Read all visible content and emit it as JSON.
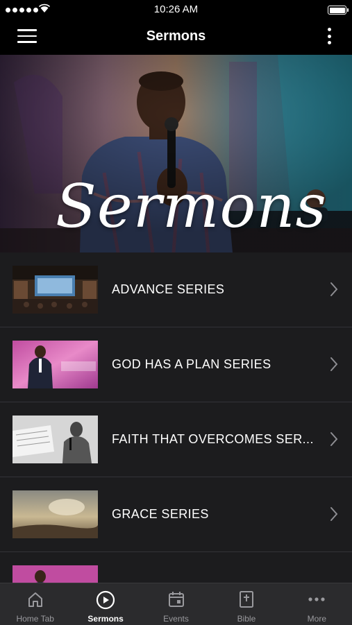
{
  "status_bar": {
    "time": "10:26 AM"
  },
  "nav": {
    "title": "Sermons"
  },
  "hero": {
    "script_text": "Sermons"
  },
  "sermon_list": [
    {
      "title": "ADVANCE SERIES"
    },
    {
      "title": "GOD HAS A PLAN SERIES"
    },
    {
      "title": "FAITH THAT OVERCOMES SER..."
    },
    {
      "title": "GRACE SERIES"
    },
    {
      "title": ""
    }
  ],
  "tabs": [
    {
      "label": "Home Tab",
      "icon": "home-icon"
    },
    {
      "label": "Sermons",
      "icon": "play-circle-icon",
      "active": true
    },
    {
      "label": "Events",
      "icon": "calendar-icon"
    },
    {
      "label": "Bible",
      "icon": "bible-icon"
    },
    {
      "label": "More",
      "icon": "more-horizontal-icon"
    }
  ],
  "colors": {
    "background": "#1c1c1e",
    "header": "#000000",
    "tab_bar": "#2b2b2d",
    "inactive": "#9a9a9e",
    "active": "#ffffff"
  }
}
